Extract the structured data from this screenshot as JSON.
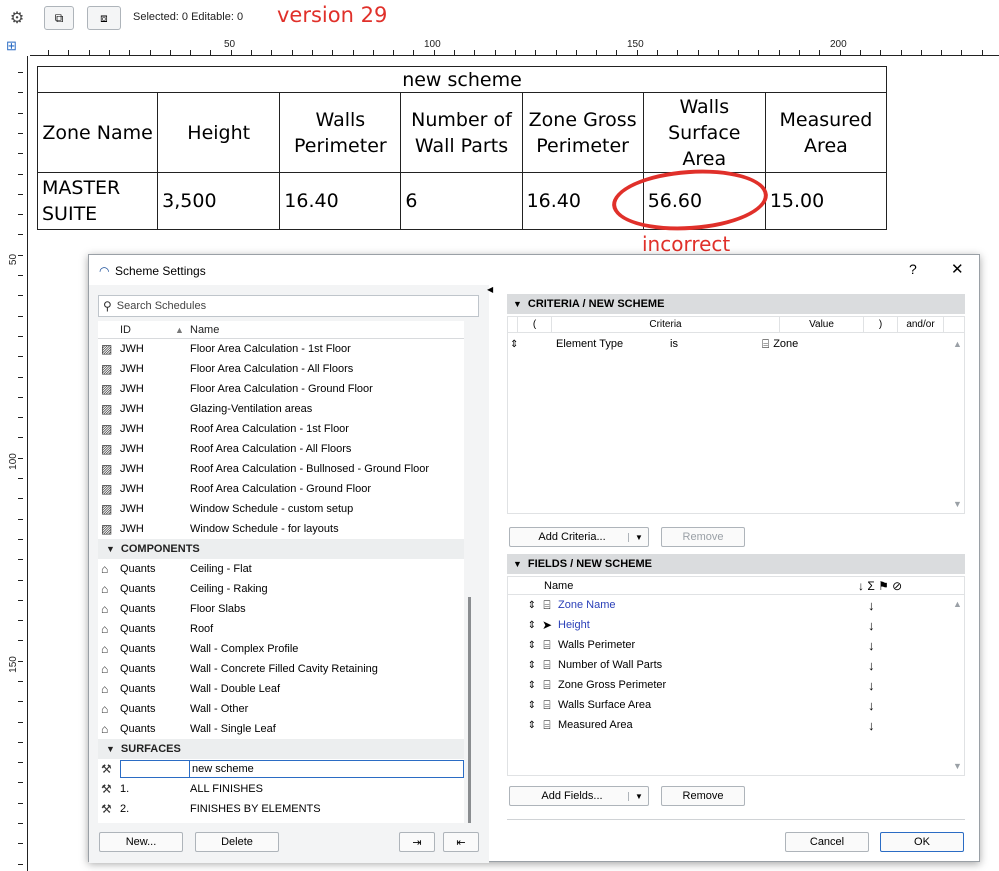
{
  "toolbar": {
    "selected_text": "Selected: 0  Editable: 0",
    "version_note": "version 29",
    "icons": [
      "gear-icon",
      "select-frame-icon",
      "select-group-icon"
    ]
  },
  "ruler": {
    "top_labels": [
      "50",
      "100",
      "150",
      "200"
    ],
    "left_labels": [
      "50",
      "100",
      "150"
    ]
  },
  "schedule": {
    "title": "new scheme",
    "headers": [
      [
        "Zone Name"
      ],
      [
        "Height"
      ],
      [
        "Walls",
        "Perimeter"
      ],
      [
        "Number of",
        "Wall Parts"
      ],
      [
        "Zone Gross",
        "Perimeter"
      ],
      [
        "Walls",
        "Surface Area"
      ],
      [
        "Measured",
        "Area"
      ]
    ],
    "row": [
      [
        "MASTER",
        "SUITE"
      ],
      [
        "3,500"
      ],
      [
        "16.40"
      ],
      [
        "6"
      ],
      [
        "16.40"
      ],
      [
        "56.60"
      ],
      [
        "15.00"
      ]
    ],
    "annotation": "incorrect",
    "annotation_color": "#e0302a"
  },
  "dialog": {
    "title": "Scheme Settings",
    "help": "?",
    "close": "✕",
    "search_placeholder": "Search Schedules",
    "list_headers": {
      "id": "ID",
      "name": "Name"
    },
    "items_top": [
      {
        "id": "JWH",
        "name": "Floor Area Calculation - 1st Floor"
      },
      {
        "id": "JWH",
        "name": "Floor Area Calculation - All Floors"
      },
      {
        "id": "JWH",
        "name": "Floor Area Calculation - Ground Floor"
      },
      {
        "id": "JWH",
        "name": "Glazing-Ventilation areas"
      },
      {
        "id": "JWH",
        "name": "Roof Area Calculation - 1st Floor"
      },
      {
        "id": "JWH",
        "name": "Roof Area Calculation - All Floors"
      },
      {
        "id": "JWH",
        "name": "Roof Area Calculation - Bullnosed - Ground Floor"
      },
      {
        "id": "JWH",
        "name": "Roof Area Calculation - Ground Floor"
      },
      {
        "id": "JWH",
        "name": "Window Schedule - custom setup"
      },
      {
        "id": "JWH",
        "name": "Window Schedule - for layouts"
      }
    ],
    "group_components": "COMPONENTS",
    "items_components": [
      {
        "id": "Quants",
        "name": "Ceiling - Flat"
      },
      {
        "id": "Quants",
        "name": "Ceiling - Raking"
      },
      {
        "id": "Quants",
        "name": "Floor Slabs"
      },
      {
        "id": "Quants",
        "name": "Roof"
      },
      {
        "id": "Quants",
        "name": "Wall - Complex Profile"
      },
      {
        "id": "Quants",
        "name": "Wall - Concrete Filled Cavity Retaining"
      },
      {
        "id": "Quants",
        "name": "Wall - Double Leaf"
      },
      {
        "id": "Quants",
        "name": "Wall - Other"
      },
      {
        "id": "Quants",
        "name": "Wall - Single Leaf"
      }
    ],
    "group_surfaces": "SURFACES",
    "items_surfaces": [
      {
        "id": "",
        "name": "new scheme",
        "selected": true
      },
      {
        "id": "1.",
        "name": "ALL FINISHES"
      },
      {
        "id": "2.",
        "name": "FINISHES BY ELEMENTS"
      }
    ],
    "btn_new": "New...",
    "btn_delete": "Delete",
    "criteria": {
      "header": "CRITERIA /  NEW SCHEME",
      "cols": [
        "(",
        "Criteria",
        "Value",
        ")",
        "and/or"
      ],
      "row": {
        "criteria": "Element Type",
        "op": "is",
        "value": "Zone"
      },
      "add": "Add Criteria...",
      "remove": "Remove"
    },
    "fields": {
      "header": "FIELDS /  NEW SCHEME",
      "col_name": "Name",
      "col_icons": "↓ Σ ⚑ ⊘",
      "items": [
        {
          "name": "Zone Name",
          "highlight": true,
          "icon": "zone-icon"
        },
        {
          "name": "Height",
          "highlight": true,
          "icon": "cursor-icon"
        },
        {
          "name": "Walls Perimeter",
          "highlight": false,
          "icon": "zone-icon"
        },
        {
          "name": "Number of Wall Parts",
          "highlight": false,
          "icon": "zone-icon"
        },
        {
          "name": "Zone Gross Perimeter",
          "highlight": false,
          "icon": "zone-icon"
        },
        {
          "name": "Walls Surface Area",
          "highlight": false,
          "icon": "zone-icon"
        },
        {
          "name": "Measured Area",
          "highlight": false,
          "icon": "zone-icon"
        }
      ],
      "sort_symbol": "↓",
      "add": "Add Fields...",
      "remove": "Remove"
    },
    "btn_cancel": "Cancel",
    "btn_ok": "OK",
    "highlight_color": "#2a3fb8"
  }
}
